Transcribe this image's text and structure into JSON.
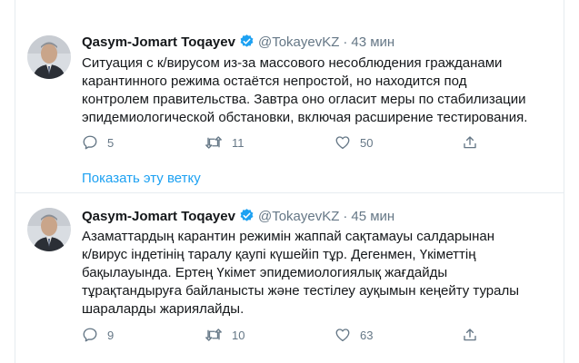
{
  "tweets": [
    {
      "name": "Qasym-Jomart Toqayev",
      "handle": "@TokayevKZ",
      "separator": "·",
      "time": "43 мин",
      "lines": [
        "Ситуация с к/вирусом из-за массового несоблюдения гражданами",
        "карантинного режима остаётся непростой, но находится под",
        "контролем правительства. Завтра оно огласит меры по стабилизации",
        "эпидемиологической обстановки, включая расширение тестирования."
      ],
      "replies": "5",
      "retweets": "11",
      "likes": "50",
      "show_thread": "Показать эту ветку"
    },
    {
      "name": "Qasym-Jomart Toqayev",
      "handle": "@TokayevKZ",
      "separator": "·",
      "time": "45 мин",
      "lines": [
        "Азаматтардың карантин режимін жаппай сақтамауы салдарынан",
        "к/вирус індетінің таралу қаупі күшейіп тұр. Дегенмен, Үкіметтің",
        "бақылауында. Ертең Үкімет эпидемиологиялық жағдайды",
        "тұрақтандыруға байланысты және тестілеу ауқымын кеңейту туралы",
        "шараларды жариялайды."
      ],
      "replies": "9",
      "retweets": "10",
      "likes": "63"
    }
  ],
  "icons": {
    "avatar": "avatar-photo",
    "verified": "verified-badge-icon",
    "reply": "reply-icon",
    "retweet": "retweet-icon",
    "like": "heart-icon",
    "share": "share-icon"
  },
  "colors": {
    "link": "#1da1f2",
    "muted": "#657786",
    "text": "#14171a",
    "border": "#e6ecf0"
  }
}
